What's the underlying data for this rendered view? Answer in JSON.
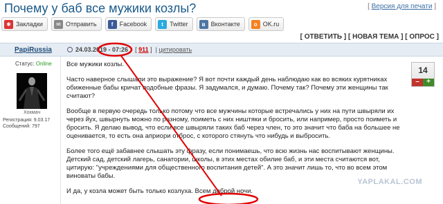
{
  "page": {
    "title": "Почему у баб все мужики козлы?",
    "print_link_prefix": "[ ",
    "print_link": "Версия для печати",
    "print_link_suffix": " ]"
  },
  "share": [
    {
      "label": "Закладки",
      "icon": "bookmark-icon",
      "color": "#d33"
    },
    {
      "label": "Отправить",
      "icon": "send-icon",
      "color": "#888"
    },
    {
      "label": "Facebook",
      "icon": "facebook-icon",
      "color": "#3b5998"
    },
    {
      "label": "Twitter",
      "icon": "twitter-icon",
      "color": "#2aa9e0"
    },
    {
      "label": "Вконтакте",
      "icon": "vk-icon",
      "color": "#4c75a3"
    },
    {
      "label": "OK.ru",
      "icon": "ok-icon",
      "color": "#f58220"
    }
  ],
  "actions": {
    "reply": "[ ОТВЕТИТЬ ]",
    "new_topic": "[ НОВАЯ ТЕМА ]",
    "poll": "[ ОПРОС ]"
  },
  "post_header": {
    "author": "PapiRussia",
    "date": "24.03.2019",
    "sep": " - ",
    "time": "07:26",
    "rep_open": "[ ",
    "rep": "911",
    "rep_close": " ]",
    "cite": "цитировать"
  },
  "sidebar": {
    "status_label": "Статус: ",
    "status_value": "Online",
    "avatar_caption": "Хохмач",
    "registered": "Регистрация: 9.03.17",
    "messages": "Сообщений: 797"
  },
  "rating": {
    "value": "14",
    "minus": "–",
    "plus": "+"
  },
  "post": {
    "p1": "Все мужики козлы.",
    "p2": "Часто наверное слышали это выражение? Я вот почти каждый день наблюдаю как во всяких курятниках обиженные бабы кричат подобные фразы. Я задумался, и думаю. Почему так? Почему эти женщины так считают?",
    "p3": "Вообще в первую очередь только потому что все мужчины которые встречались у них на пути швыряли их через йух, швырнуть можно по разному, поиметь с них ништяки и бросить, или например, просто поиметь и бросить. Я делаю вывод, что если все швыряли таких баб через член, то это значит что баба на большее не оценивается, то есть она априори отброс, с которого стянуть что нибудь и выбросить.",
    "p4": "Более того ещё забавнее слышать эту фразу, если понимаешь, что всю жизнь нас воспитывают женщины. Детский сад, детский лагерь, санатории, школы, в этих местах обилие баб, и эти места считаются вот, цитирую: \"учреждениями для общественного воспитания детей\". А это значит лишь то, что во всем этом виноваты бабы.",
    "p5": "И да, у козла может быть только козлуха. Всем доброй ночи."
  },
  "watermark": "YAPLAKAL.COM",
  "colors": {
    "title": "#1a5a8a",
    "header_bg": "#e6ecf3",
    "annotation": "#e00000",
    "online": "#2a9a2a"
  }
}
